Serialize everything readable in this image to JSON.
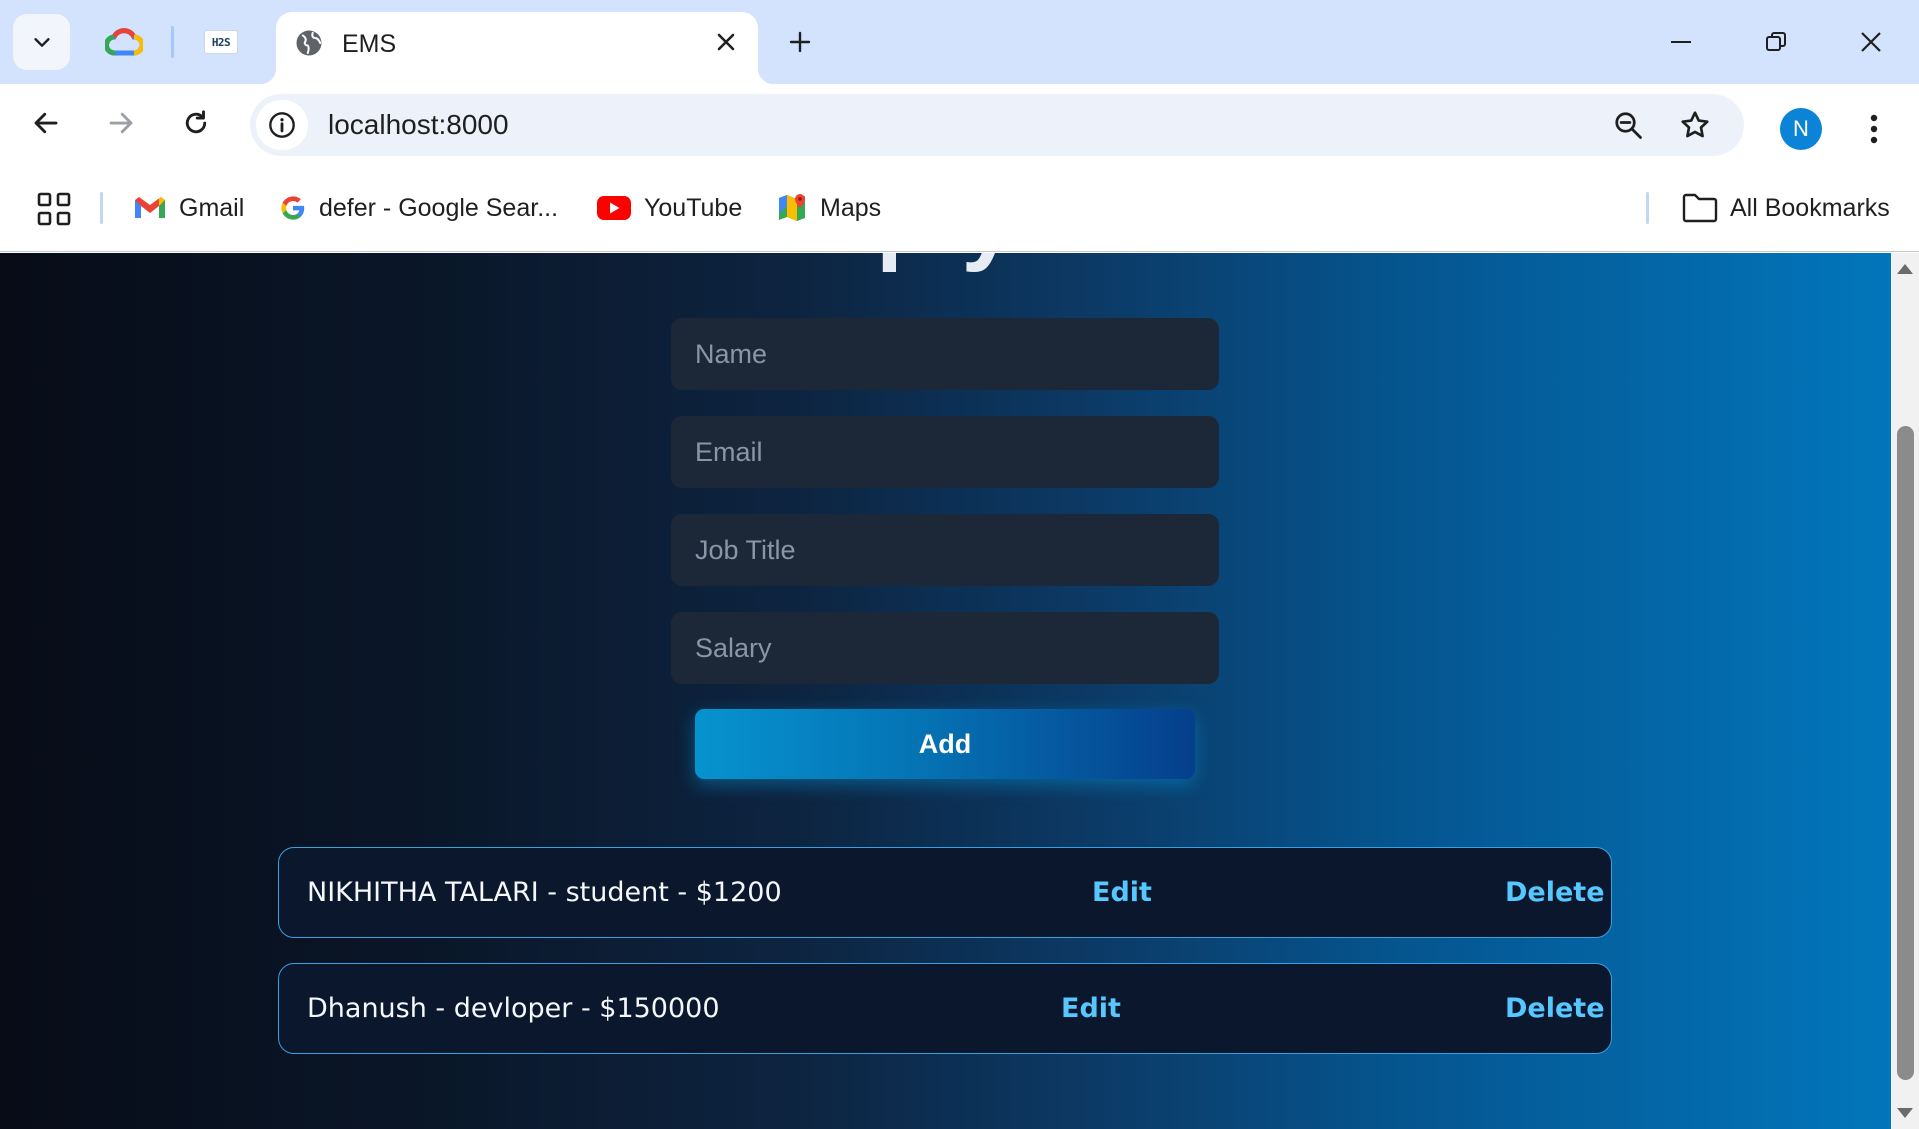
{
  "browser": {
    "active_tab": {
      "title": "EMS"
    },
    "address_bar": {
      "url": "localhost:8000"
    },
    "pinned_tabs": [
      "cloud-icon",
      "h2s-icon"
    ],
    "pinned_h2s_text": "H2S",
    "profile_initial": "N"
  },
  "bookmarks": {
    "items": [
      {
        "label": "Gmail"
      },
      {
        "label": "defer - Google Sear..."
      },
      {
        "label": "YouTube"
      },
      {
        "label": "Maps"
      }
    ],
    "all_bookmarks": "All Bookmarks"
  },
  "form": {
    "name_placeholder": "Name",
    "email_placeholder": "Email",
    "job_placeholder": "Job Title",
    "salary_placeholder": "Salary",
    "add_label": "Add"
  },
  "employees": [
    {
      "text": "NIKHITHA TALARI - student - $1200",
      "edit": "Edit",
      "delete": "Delete"
    },
    {
      "text": "Dhanush - devloper - $150000",
      "edit": "Edit",
      "delete": "Delete"
    }
  ],
  "colors": {
    "tabstrip": "#d3e3fd",
    "accent": "#56c7ff",
    "button_start": "#0693cf",
    "button_end": "#053f8c",
    "avatar": "#0b84d8"
  }
}
